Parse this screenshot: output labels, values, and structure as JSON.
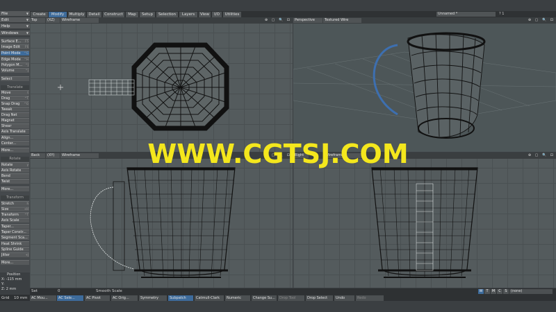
{
  "top_menus": [
    {
      "label": "File"
    },
    {
      "label": "Edit"
    },
    {
      "label": "Help"
    },
    {
      "label": "Windows"
    }
  ],
  "tabs": [
    "Create",
    "Modify",
    "Multiply",
    "Detail",
    "Construct",
    "Map",
    "Setup",
    "Selection",
    "Layers",
    "View",
    "I/O",
    "Utilities"
  ],
  "active_tab": "Modify",
  "document_title": "Unnamed *",
  "toolbar_right": "? 1",
  "left_menu": [
    {
      "label": "Surface E...",
      "sc": "F5"
    },
    {
      "label": "Image Edit",
      "sc": "F6"
    },
    {
      "label": "Point Mode",
      "sc": "^G",
      "sel": true
    },
    {
      "label": "Edge Mode",
      "sc": "^H"
    },
    {
      "label": "Polygon M...",
      "sc": "^J"
    },
    {
      "label": "Volume",
      "sc": "^J"
    },
    {
      "label": "Select",
      "sc": ""
    },
    {
      "label": "Translate",
      "hdr": true
    },
    {
      "label": "Move",
      "sc": "t"
    },
    {
      "label": "Drag",
      "sc": "^T"
    },
    {
      "label": "Snap Drag",
      "sc": "^G"
    },
    {
      "label": "Tweak",
      "sc": ""
    },
    {
      "label": "Drag Net",
      "sc": ""
    },
    {
      "label": "Magnet",
      "sc": ""
    },
    {
      "label": "Shear",
      "sc": ""
    },
    {
      "label": "Axis Translate",
      "sc": ""
    },
    {
      "label": "Align...",
      "sc": ""
    },
    {
      "label": "Center...",
      "sc": ""
    },
    {
      "label": "More...",
      "sc": ""
    },
    {
      "label": "Rotate",
      "hdr": true
    },
    {
      "label": "Rotate",
      "sc": "y"
    },
    {
      "label": "Axis Rotate",
      "sc": ""
    },
    {
      "label": "Bend",
      "sc": ""
    },
    {
      "label": "Twist",
      "sc": ""
    },
    {
      "label": "More...",
      "sc": ""
    },
    {
      "label": "Transform",
      "hdr": true
    },
    {
      "label": "Stretch",
      "sc": "h"
    },
    {
      "label": "Size",
      "sc": "+H"
    },
    {
      "label": "Transform",
      "sc": "^T"
    },
    {
      "label": "Axis Scale",
      "sc": ""
    },
    {
      "label": "Taper...",
      "sc": ""
    },
    {
      "label": "Taper Constr...",
      "sc": ""
    },
    {
      "label": "Segment Sca...",
      "sc": ""
    },
    {
      "label": "Heat Shrink",
      "sc": ""
    },
    {
      "label": "Spline Guide",
      "sc": ""
    },
    {
      "label": "Jitter",
      "sc": "+J"
    },
    {
      "label": "More...",
      "sc": ""
    }
  ],
  "viewports": [
    {
      "view": "Top",
      "axis": "(XZ)",
      "mode": "Wireframe"
    },
    {
      "view": "Perspective",
      "axis": "",
      "mode": "Textured Wire"
    },
    {
      "view": "Back",
      "axis": "(XY)",
      "mode": "Wireframe"
    },
    {
      "view": "Right",
      "axis": "",
      "mode": "Wireframe"
    }
  ],
  "viewport_icons": "⊕ ▢ 🔍 ⊡",
  "watermark": "WWW.CGTSJ.COM",
  "position": {
    "title": "Position",
    "x": "X: -115 mm",
    "y": "Y:",
    "z": "Z: 2 mm"
  },
  "info": {
    "set_label": "Set",
    "set_value": "0",
    "mode": "Smooth Scale"
  },
  "grid": {
    "label": "Grid",
    "value": "10 mm"
  },
  "bottom_buttons": [
    {
      "label": "AC Mou...",
      "on": false
    },
    {
      "label": "AC Sele...",
      "on": true
    },
    {
      "label": "AC Pivot",
      "on": false
    },
    {
      "label": "AC Orig...",
      "on": false
    },
    {
      "label": "Symmetry",
      "on": false
    },
    {
      "label": "Subpatch",
      "on": true
    },
    {
      "label": "Catmull-Clark",
      "on": false
    },
    {
      "label": "Numeric",
      "on": false
    },
    {
      "label": "Change Su...",
      "on": false
    },
    {
      "label": "Drop Tool",
      "on": false,
      "dim": true
    },
    {
      "label": "Drop Select",
      "on": false
    },
    {
      "label": "Undo",
      "on": false
    },
    {
      "label": "Redo",
      "on": false,
      "dim": true
    }
  ],
  "wtmcs": [
    "W",
    "T",
    "M",
    "C",
    "S"
  ],
  "selection_dropdown": "(none)",
  "colors": {
    "accent": "#3d6b9b",
    "watermark": "#f4e71d",
    "viewport": "#545b5d"
  }
}
